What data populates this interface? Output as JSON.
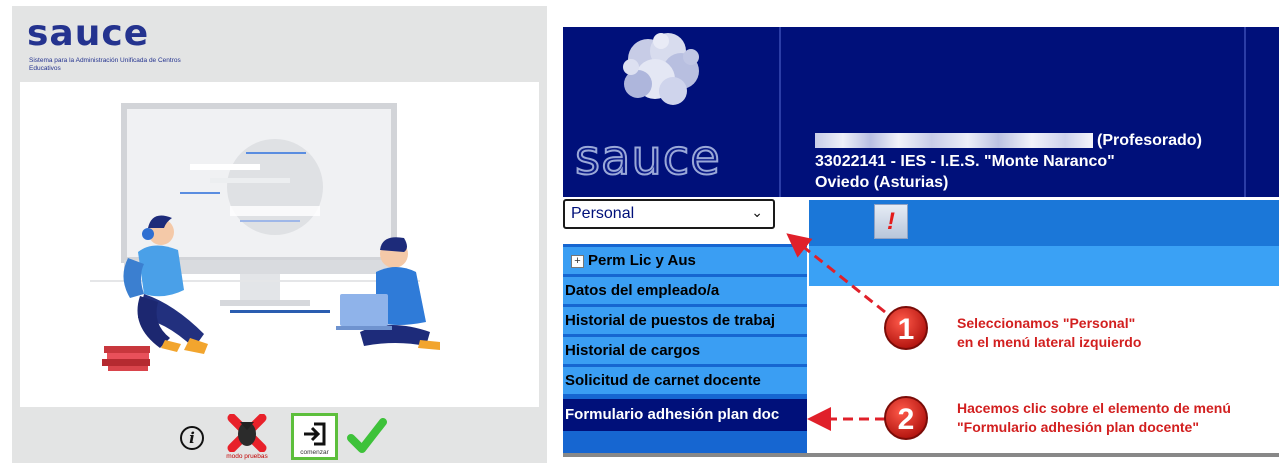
{
  "left": {
    "logo_text": "sauce",
    "logo_subtitle": "Sistema para la Administración Unificada de Centros Educativos",
    "toolbar": {
      "info_icon": "info-icon",
      "info_glyph": "i",
      "test_mode_label": "modo pruebas",
      "start_label": "comenzar",
      "confirm_icon": "checkmark-icon"
    }
  },
  "right": {
    "logo_text": "sauce",
    "user": {
      "role": "(Profesorado)",
      "center": "33022141 - IES - I.E.S. \"Monte Naranco\"",
      "location": "Oviedo (Asturias)"
    },
    "menu_select": {
      "value": "Personal",
      "icon": "chevron-down-icon"
    },
    "alert_glyph": "!",
    "nav_items": [
      {
        "label": "Perm Lic y Aus",
        "expandable": true
      },
      {
        "label": "Datos del empleado/a"
      },
      {
        "label": "Historial de puestos de trabaj"
      },
      {
        "label": "Historial de cargos"
      },
      {
        "label": "Solicitud de carnet docente"
      },
      {
        "label": "Formulario adhesión plan doc",
        "active": true
      }
    ],
    "annotations": [
      {
        "number": "1",
        "line1": "Seleccionamos \"Personal\"",
        "line2": "en el menú lateral izquierdo"
      },
      {
        "number": "2",
        "line1": "Hacemos clic sobre el elemento de menú",
        "line2": "\"Formulario adhesión plan docente\""
      }
    ]
  },
  "colors": {
    "header_blue": "#00107a",
    "nav_blue": "#3a9ef3",
    "annotation_red": "#d21f1f",
    "start_green": "#5dbf3c"
  }
}
